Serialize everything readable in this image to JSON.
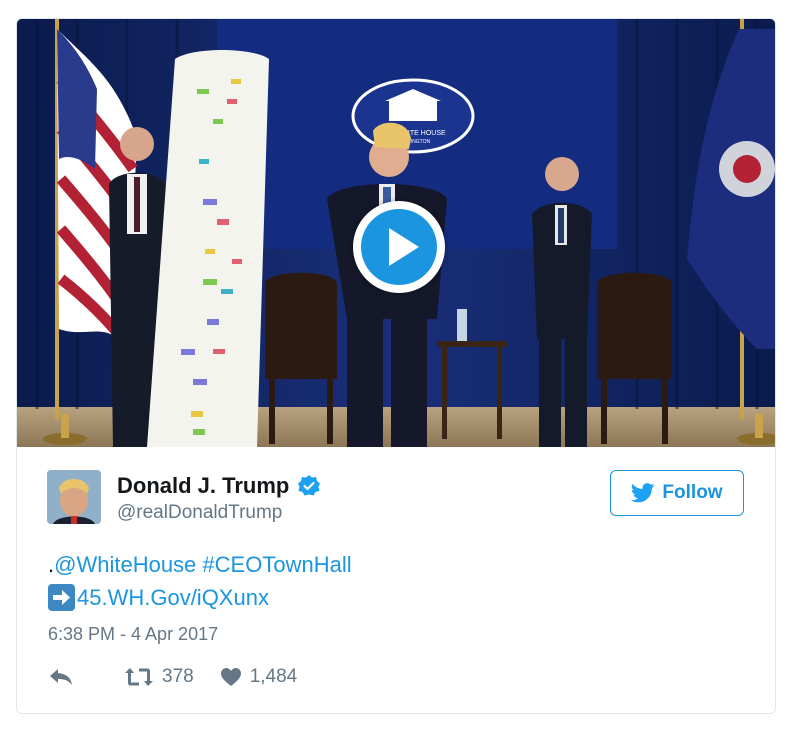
{
  "tweet": {
    "author_name": "Donald J. Trump",
    "handle": "@realDonaldTrump",
    "follow_label": "Follow",
    "text_line1_prefix": ".",
    "mention": "@WhiteHouse",
    "hashtag": "#CEOTownHall",
    "link": "45.WH.Gov/iQXunx",
    "timestamp": "6:38 PM - 4 Apr 2017",
    "retweets": "378",
    "likes": "1,484"
  },
  "media": {
    "seal_text": "THE WHITE HOUSE",
    "seal_subtext": "WASHINGTON"
  },
  "icons": {
    "verified": "verified-badge-icon",
    "follow_bird": "twitter-bird-icon",
    "play": "play-icon",
    "reply": "reply-icon",
    "retweet": "retweet-icon",
    "like": "heart-icon",
    "link_arrow": "right-arrow-emoji-icon"
  },
  "colors": {
    "accent": "#1b95e0",
    "muted": "#657786",
    "text": "#14171a",
    "border": "#e1e8ed"
  }
}
